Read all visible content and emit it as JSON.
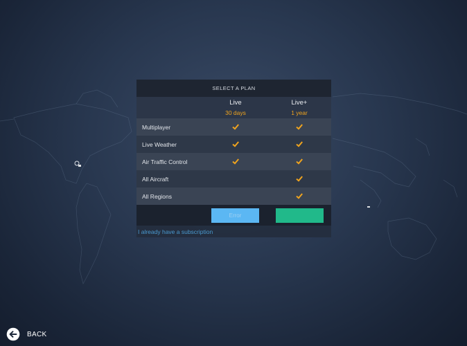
{
  "panel": {
    "title": "SELECT A PLAN",
    "plans": [
      {
        "name": "Live",
        "duration": "30 days"
      },
      {
        "name": "Live+",
        "duration": "1 year"
      }
    ],
    "features": [
      {
        "name": "Multiplayer",
        "live": true,
        "live_plus": true
      },
      {
        "name": "Live Weather",
        "live": true,
        "live_plus": true
      },
      {
        "name": "Air Traffic Control",
        "live": true,
        "live_plus": true
      },
      {
        "name": "All Aircraft",
        "live": false,
        "live_plus": true
      },
      {
        "name": "All Regions",
        "live": false,
        "live_plus": true
      }
    ],
    "buttons": {
      "live_label": "Error",
      "live_plus_label": ""
    },
    "subscription_link": "I already have a subscription"
  },
  "navigation": {
    "back_label": "BACK",
    "back_icon": "arrow-left-circle-icon"
  },
  "colors": {
    "accent_orange": "#f0a41e",
    "check": "#f0a41e",
    "button_live": "#5bb7f3",
    "button_live_plus": "#21b98a",
    "link": "#4a9ad0"
  }
}
